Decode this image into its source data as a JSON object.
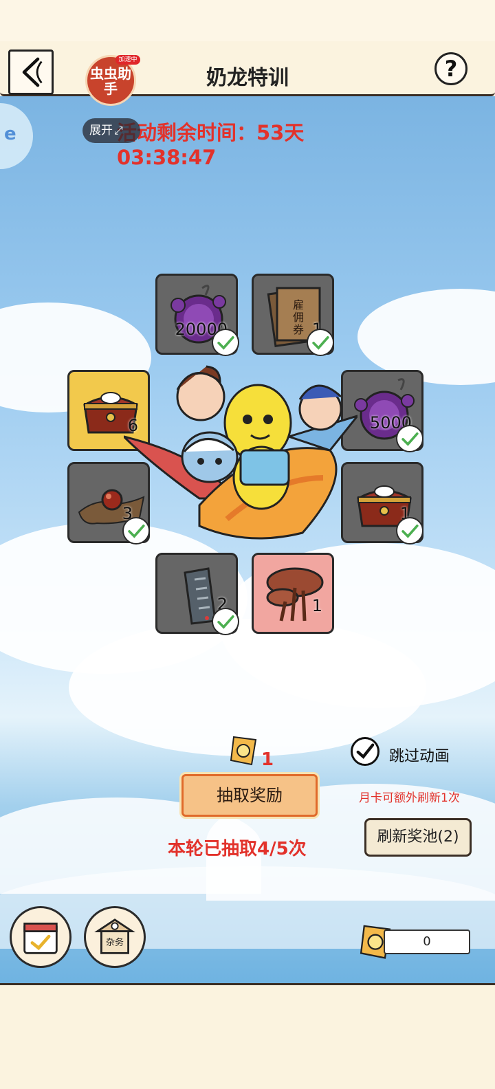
{
  "header": {
    "title": "奶龙特训",
    "help_label": "?"
  },
  "helper": {
    "badge_text": "虫虫助手",
    "accel_tag": "加速中",
    "expand_label": "展开"
  },
  "event": {
    "countdown": "活动剩余时间：53天 03:38:47"
  },
  "side_tab": {
    "label": "e"
  },
  "rewards": [
    {
      "name": "purple-orb",
      "qty": "20000",
      "claimed": true
    },
    {
      "name": "hire-ticket",
      "qty": "1",
      "claimed": true
    },
    {
      "name": "gold-chest",
      "qty": "6",
      "claimed": false
    },
    {
      "name": "purple-orb",
      "qty": "5000",
      "claimed": true
    },
    {
      "name": "red-bead-cloth",
      "qty": "3",
      "claimed": true
    },
    {
      "name": "treasure-chest",
      "qty": "1",
      "claimed": true
    },
    {
      "name": "scroll-talisman",
      "qty": "2",
      "claimed": true
    },
    {
      "name": "lingzhi-mushroom",
      "qty": "1",
      "claimed": false
    }
  ],
  "draw": {
    "cost": "1",
    "button_label": "抽取奖励",
    "rounds_info": "本轮已抽取4/5次"
  },
  "skip_animation": {
    "label": "跳过动画",
    "checked": true
  },
  "refresh": {
    "note": "月卡可额外刷新1次",
    "button_label": "刷新奖池(2)"
  },
  "bottom": {
    "sundries_label": "杂务",
    "ticket_balance": "0"
  },
  "colors": {
    "accent_red": "#e2322b",
    "gold_card": "#f2c94c",
    "gray_card": "#666666",
    "draw_button": "#f6c287"
  }
}
